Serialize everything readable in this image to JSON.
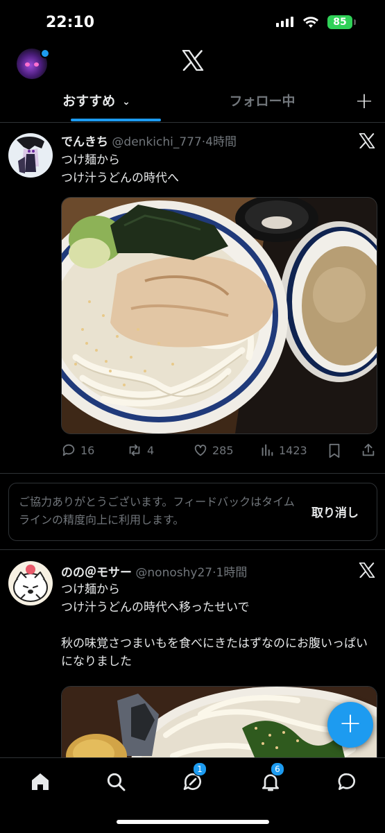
{
  "status_bar": {
    "time": "22:10",
    "battery": "85"
  },
  "tabs": {
    "for_you": "おすすめ",
    "following": "フォロー中"
  },
  "posts": [
    {
      "name": "でんきち",
      "handle": "@denkichi_777",
      "time": "4時間",
      "text": "つけ麺から\nつけ汁うどんの時代へ",
      "stats": {
        "replies": "16",
        "reposts": "4",
        "likes": "285",
        "views": "1423"
      }
    },
    {
      "name": "のの＠モサー",
      "handle": "@nonoshy27",
      "time": "1時間",
      "text": "つけ麺から\nつけ汁うどんの時代へ移ったせいで\n\n秋の味覚さつまいもを食べにきたはずなのにお腹いっぱいになりました"
    }
  ],
  "feedback": {
    "message": "ご協力ありがとうございます。フィードバックはタイムラインの精度向上に利用します。",
    "undo": "取り消し"
  },
  "nav": {
    "messages_badge": "1",
    "notifications_badge": "6"
  },
  "colors": {
    "accent": "#1d9bf0",
    "background": "#000000",
    "muted": "#71767b"
  }
}
